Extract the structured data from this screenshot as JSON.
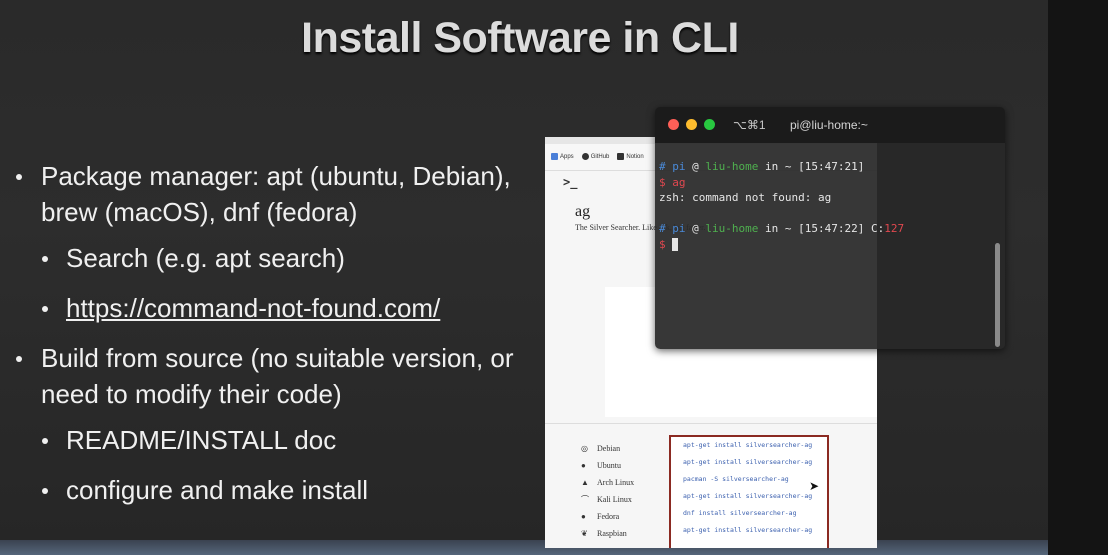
{
  "slide": {
    "title": "Install Software in CLI",
    "bullets": [
      {
        "level": 1,
        "text": "Package manager: apt (ubuntu, Debian), brew (macOS), dnf (fedora)"
      },
      {
        "level": 2,
        "text": "Search (e.g. apt search)"
      },
      {
        "level": 2,
        "text": "https://command-not-found.com/",
        "link": true
      },
      {
        "level": 1,
        "text": "Build from source (no suitable version, or need to modify their code)"
      },
      {
        "level": 2,
        "text": "README/INSTALL doc"
      },
      {
        "level": 2,
        "text": "configure and make install"
      }
    ]
  },
  "browser": {
    "bookmarks": [
      {
        "label": "Apps",
        "icon": "apps-grid-icon"
      },
      {
        "label": "GitHub",
        "icon": "github-icon"
      },
      {
        "label": "Notion",
        "icon": "notion-icon"
      }
    ],
    "page": {
      "prompt_symbol": ">_",
      "package_name": "ag",
      "description": "The Silver Searcher. Like ack, but faster.",
      "distros": [
        {
          "name": "Debian",
          "icon": "debian-icon",
          "command": "apt-get install silversearcher-ag"
        },
        {
          "name": "Ubuntu",
          "icon": "ubuntu-icon",
          "command": "apt-get install silversearcher-ag"
        },
        {
          "name": "Arch Linux",
          "icon": "arch-icon",
          "command": "pacman -S silversearcher-ag"
        },
        {
          "name": "Kali Linux",
          "icon": "kali-icon",
          "command": "apt-get install silversearcher-ag"
        },
        {
          "name": "Fedora",
          "icon": "fedora-icon",
          "command": "dnf install silversearcher-ag"
        },
        {
          "name": "Raspbian",
          "icon": "raspbian-icon",
          "command": "apt-get install silversearcher-ag"
        }
      ]
    }
  },
  "terminal": {
    "shortcut": "⌥⌘1",
    "title": "pi@liu-home:~",
    "lines": [
      [
        {
          "t": "# ",
          "c": "#4a8ad8"
        },
        {
          "t": "pi",
          "c": "#4a8ad8"
        },
        {
          "t": " @ ",
          "c": "#e6e6e6"
        },
        {
          "t": "liu-home",
          "c": "#4fb04f"
        },
        {
          "t": " in ~ ",
          "c": "#e6e6e6"
        },
        {
          "t": "[15:47:21]",
          "c": "#e6e6e6"
        }
      ],
      [
        {
          "t": "$ ",
          "c": "#e0484f"
        },
        {
          "t": "ag",
          "c": "#e0484f"
        }
      ],
      [
        {
          "t": "zsh: command not found: ag",
          "c": "#e6e6e6"
        }
      ],
      [
        {
          "t": "",
          "c": "#e6e6e6"
        }
      ],
      [
        {
          "t": "# ",
          "c": "#4a8ad8"
        },
        {
          "t": "pi",
          "c": "#4a8ad8"
        },
        {
          "t": " @ ",
          "c": "#e6e6e6"
        },
        {
          "t": "liu-home",
          "c": "#4fb04f"
        },
        {
          "t": " in ~ ",
          "c": "#e6e6e6"
        },
        {
          "t": "[15:47:22]",
          "c": "#e6e6e6"
        },
        {
          "t": " C:",
          "c": "#e6e6e6"
        },
        {
          "t": "127",
          "c": "#e0484f"
        }
      ],
      [
        {
          "t": "$ ",
          "c": "#e0484f"
        }
      ]
    ],
    "colors": {
      "red": "#ff5f57",
      "yellow": "#febc2e",
      "green": "#28c840"
    }
  }
}
